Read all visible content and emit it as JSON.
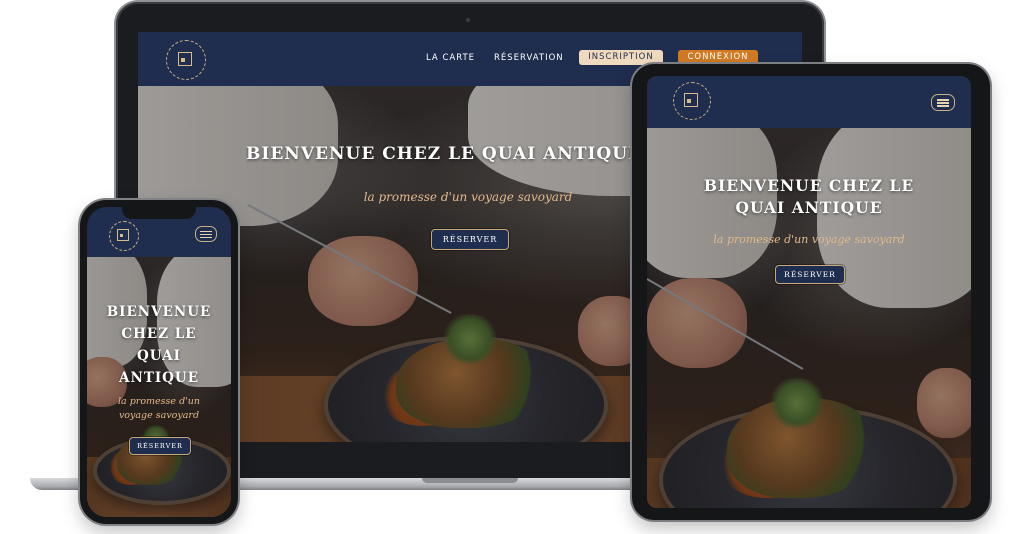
{
  "brand": {
    "logo_alt": "Le Quai Antique logo",
    "colors": {
      "navy": "#1f2e4e",
      "gold": "#c6a97b",
      "peach": "#e3b88a",
      "orange": "#d17a22"
    }
  },
  "laptop": {
    "nav": {
      "menu_label": "LA CARTE",
      "reservation_label": "RÉSERVATION",
      "signup_label": "INSCRIPTION",
      "login_label": "CONNEXION"
    },
    "hero": {
      "title": "BIENVENUE CHEZ LE QUAI ANTIQUE",
      "subtitle": "la promesse d'un voyage savoyard",
      "cta_label": "RÉSERVER"
    }
  },
  "tablet": {
    "menu_icon": "hamburger-icon",
    "hero": {
      "title_line1": "BIENVENUE CHEZ LE",
      "title_line2": "QUAI ANTIQUE",
      "subtitle": "la promesse d'un voyage savoyard",
      "cta_label": "RÉSERVER"
    }
  },
  "phone": {
    "menu_icon": "hamburger-icon",
    "hero": {
      "title_line1": "BIENVENUE",
      "title_line2": "CHEZ LE",
      "title_line3": "QUAI",
      "title_line4": "ANTIQUE",
      "subtitle_line1": "la promesse d'un",
      "subtitle_line2": "voyage savoyard",
      "cta_label": "RÉSERVER"
    }
  }
}
